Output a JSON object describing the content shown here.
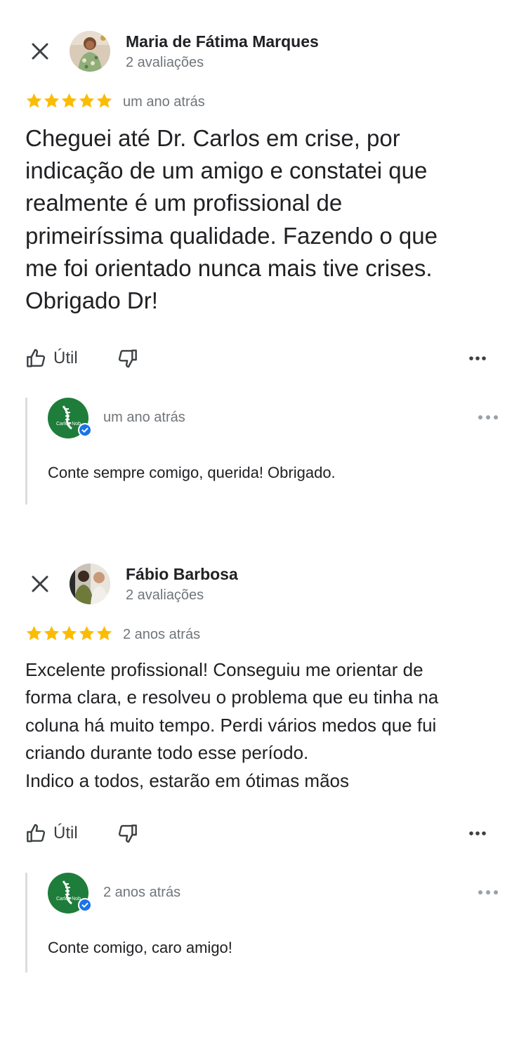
{
  "colors": {
    "star": "#fbbc04",
    "secondary_text": "#70757a",
    "primary_text": "#202124",
    "reply_border": "#dadce0",
    "owner_logo_bg": "#1e7d3a",
    "verified_badge": "#1a73e8"
  },
  "icons": {
    "close": "close-icon",
    "star": "star-icon",
    "thumbs_up": "thumbs-up-icon",
    "thumbs_down": "thumbs-down-icon",
    "more": "more-horizontal-icon",
    "verified": "verified-badge-icon"
  },
  "reviews": [
    {
      "author_name": "Maria de Fátima Marques",
      "author_reviews": "2 avaliações",
      "rating": 5,
      "date": "um ano atrás",
      "text": "Cheguei até Dr. Carlos em crise, por\nindicação de um amigo e constatei que\nrealmente é um profissional de\nprimeiríssima qualidade. Fazendo o que\nme foi orientado nunca mais tive crises.\nObrigado Dr!",
      "helpful_label": "Útil",
      "owner_reply": {
        "owner_logo_text": "Carlos Nob",
        "date": "um ano atrás",
        "text": "Conte sempre comigo, querida! Obrigado."
      }
    },
    {
      "author_name": "Fábio Barbosa",
      "author_reviews": "2 avaliações",
      "rating": 5,
      "date": "2 anos atrás",
      "text": "Excelente profissional! Conseguiu me orientar de\nforma clara, e resolveu o problema que eu tinha na\ncoluna há muito tempo. Perdi vários medos que fui\ncriando durante todo esse período.\nIndico a todos, estarão em ótimas mãos",
      "helpful_label": "Útil",
      "owner_reply": {
        "owner_logo_text": "Carlos Nob",
        "date": "2 anos atrás",
        "text": "Conte comigo, caro amigo!"
      }
    }
  ]
}
